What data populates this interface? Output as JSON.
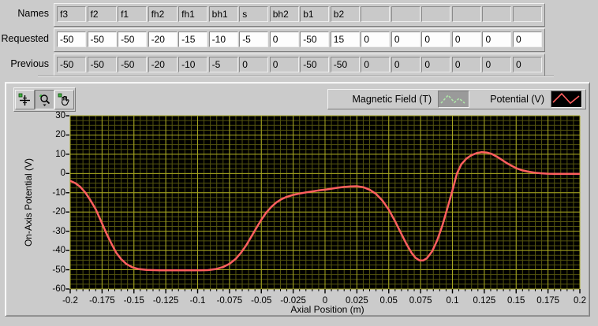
{
  "panel": {
    "bg": "#cbcbcb"
  },
  "io_table": {
    "rows": [
      {
        "label": "Names",
        "editable": false,
        "values": [
          "f3",
          "f2",
          "f1",
          "fh2",
          "fh1",
          "bh1",
          "s",
          "bh2",
          "b1",
          "b2",
          "",
          "",
          "",
          "",
          "",
          ""
        ]
      },
      {
        "label": "Requested",
        "editable": true,
        "values": [
          "-50",
          "-50",
          "-50",
          "-20",
          "-15",
          "-10",
          "-5",
          "0",
          "-50",
          "15",
          "0",
          "0",
          "0",
          "0",
          "0",
          "0"
        ]
      },
      {
        "label": "Previous",
        "editable": false,
        "values": [
          "-50",
          "-50",
          "-50",
          "-20",
          "-10",
          "-5",
          "0",
          "0",
          "-50",
          "-50",
          "0",
          "0",
          "0",
          "0",
          "0",
          "0"
        ]
      }
    ]
  },
  "graph": {
    "toolbar": [
      {
        "id": "cursor-tool",
        "pressed": false
      },
      {
        "id": "zoom-tool",
        "pressed": true
      },
      {
        "id": "pan-tool",
        "pressed": false
      }
    ],
    "legend": [
      {
        "label": "Magnetic Field (T)",
        "sample_color": "#aee8a8",
        "sample_bg": "#9a9a9a",
        "style": "dashed"
      },
      {
        "label": "Potential (V)",
        "sample_color": "#ff5f5f",
        "sample_bg": "#000000",
        "style": "solid"
      }
    ]
  },
  "chart_data": {
    "type": "line",
    "xlabel": "Axial Position (m)",
    "ylabel": "On-Axis Potential (V)",
    "xlim": [
      -0.2,
      0.2
    ],
    "ylim": [
      -60,
      30
    ],
    "x_ticks": [
      -0.2,
      -0.175,
      -0.15,
      -0.125,
      -0.1,
      -0.075,
      -0.05,
      -0.025,
      0,
      0.025,
      0.05,
      0.075,
      0.1,
      0.125,
      0.15,
      0.175,
      0.2
    ],
    "x_tick_labels": [
      "-0.2",
      "-0.175",
      "-0.15",
      "-0.125",
      "-0.1",
      "-0.075",
      "-0.05",
      "-0.025",
      "0",
      "0.025",
      "0.05",
      "0.075",
      "0.1",
      "0.125",
      "0.15",
      "0.175",
      "0.2"
    ],
    "y_ticks": [
      30,
      20,
      10,
      0,
      -10,
      -20,
      -30,
      -40,
      -50,
      -60
    ],
    "y_tick_labels": [
      "30",
      "20",
      "10",
      "0",
      "-10",
      "-20",
      "-30",
      "-40",
      "-50",
      "-60"
    ],
    "x_minor_step": 0.005,
    "y_minor_step": 2.5,
    "grid": true,
    "plot_bg": "#000000",
    "grid_major_color": "#a6a621",
    "grid_minor_color": "#55550f",
    "tick_color": "#000000",
    "legend_position": "top-right",
    "series": [
      {
        "name": "Magnetic Field (T)",
        "color": "#aee8a8",
        "style": "dashed",
        "visible": false,
        "points": []
      },
      {
        "name": "Potential (V)",
        "color": "#ff5f5f",
        "style": "solid",
        "visible": true,
        "points": [
          [
            -0.2,
            -3.8
          ],
          [
            -0.196,
            -5.0
          ],
          [
            -0.192,
            -7.0
          ],
          [
            -0.188,
            -10.0
          ],
          [
            -0.184,
            -14.0
          ],
          [
            -0.18,
            -18.5
          ],
          [
            -0.176,
            -24.5
          ],
          [
            -0.172,
            -30.5
          ],
          [
            -0.168,
            -36.0
          ],
          [
            -0.164,
            -41.0
          ],
          [
            -0.16,
            -44.5
          ],
          [
            -0.156,
            -47.0
          ],
          [
            -0.151,
            -48.8
          ],
          [
            -0.146,
            -49.7
          ],
          [
            -0.14,
            -50.1
          ],
          [
            -0.13,
            -50.3
          ],
          [
            -0.115,
            -50.3
          ],
          [
            -0.1,
            -50.3
          ],
          [
            -0.092,
            -50.2
          ],
          [
            -0.086,
            -49.7
          ],
          [
            -0.08,
            -48.6
          ],
          [
            -0.075,
            -46.9
          ],
          [
            -0.07,
            -44.3
          ],
          [
            -0.066,
            -41.2
          ],
          [
            -0.062,
            -37.4
          ],
          [
            -0.058,
            -33.0
          ],
          [
            -0.054,
            -28.4
          ],
          [
            -0.05,
            -24.0
          ],
          [
            -0.046,
            -20.2
          ],
          [
            -0.042,
            -17.2
          ],
          [
            -0.038,
            -14.9
          ],
          [
            -0.034,
            -13.3
          ],
          [
            -0.03,
            -12.1
          ],
          [
            -0.025,
            -11.1
          ],
          [
            -0.02,
            -10.4
          ],
          [
            -0.015,
            -9.8
          ],
          [
            -0.01,
            -9.3
          ],
          [
            -0.005,
            -8.8
          ],
          [
            0.0,
            -8.4
          ],
          [
            0.005,
            -7.9
          ],
          [
            0.01,
            -7.4
          ],
          [
            0.015,
            -7.0
          ],
          [
            0.02,
            -6.7
          ],
          [
            0.025,
            -6.6
          ],
          [
            0.03,
            -7.1
          ],
          [
            0.035,
            -8.4
          ],
          [
            0.04,
            -10.6
          ],
          [
            0.045,
            -14.0
          ],
          [
            0.05,
            -18.8
          ],
          [
            0.055,
            -24.8
          ],
          [
            0.06,
            -31.5
          ],
          [
            0.064,
            -36.8
          ],
          [
            0.068,
            -41.3
          ],
          [
            0.071,
            -43.8
          ],
          [
            0.074,
            -45.1
          ],
          [
            0.077,
            -45.2
          ],
          [
            0.08,
            -44.0
          ],
          [
            0.084,
            -40.5
          ],
          [
            0.088,
            -34.8
          ],
          [
            0.092,
            -27.2
          ],
          [
            0.096,
            -18.2
          ],
          [
            0.1,
            -8.8
          ],
          [
            0.1035,
            0.0
          ],
          [
            0.107,
            4.8
          ],
          [
            0.111,
            7.8
          ],
          [
            0.115,
            9.5
          ],
          [
            0.119,
            10.6
          ],
          [
            0.123,
            11.1
          ],
          [
            0.127,
            10.9
          ],
          [
            0.131,
            10.1
          ],
          [
            0.135,
            8.7
          ],
          [
            0.139,
            7.0
          ],
          [
            0.143,
            5.3
          ],
          [
            0.147,
            3.8
          ],
          [
            0.151,
            2.5
          ],
          [
            0.155,
            1.6
          ],
          [
            0.16,
            0.9
          ],
          [
            0.165,
            0.4
          ],
          [
            0.17,
            0.1
          ],
          [
            0.175,
            -0.1
          ],
          [
            0.18,
            -0.2
          ],
          [
            0.19,
            -0.2
          ],
          [
            0.2,
            -0.2
          ]
        ]
      }
    ]
  }
}
